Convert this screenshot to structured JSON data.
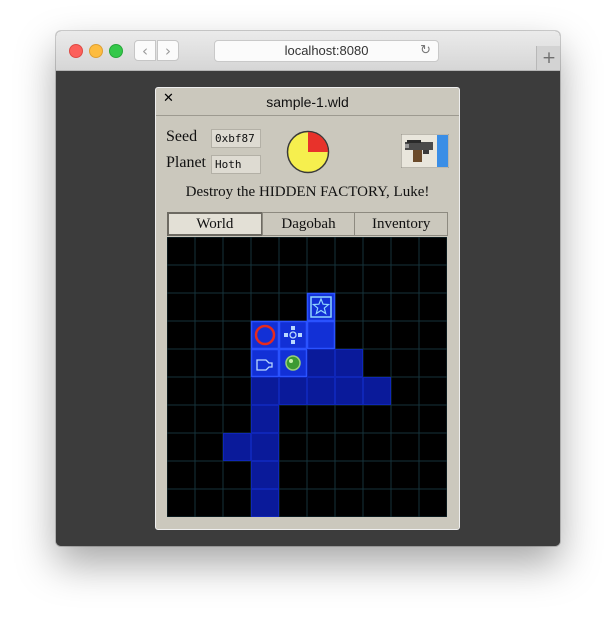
{
  "browser": {
    "url": "localhost:8080",
    "back_glyph": "‹",
    "forward_glyph": "›",
    "reload_glyph": "↻",
    "new_tab_glyph": "+"
  },
  "dialog": {
    "close_glyph": "✕",
    "title": "sample-1.wld"
  },
  "fields": {
    "seed_label": "Seed",
    "seed_value": "0xbf87",
    "planet_label": "Planet",
    "planet_value": "Hoth"
  },
  "objective": "Destroy the HIDDEN FACTORY, Luke!",
  "progress": {
    "red_fraction": 0.25,
    "red_color": "#e8322b",
    "yellow_color": "#f6ef4e"
  },
  "tabs": [
    {
      "label": "World",
      "active": true
    },
    {
      "label": "Dagobah",
      "active": false
    },
    {
      "label": "Inventory",
      "active": false
    }
  ],
  "map": {
    "cols": 10,
    "rows": 10,
    "grid_color": "#16323a",
    "zone_color": "#0a1a9a",
    "highlight_color": "#2a52ff",
    "zones": [
      [
        5,
        2
      ],
      [
        3,
        3
      ],
      [
        4,
        3
      ],
      [
        5,
        3
      ],
      [
        3,
        4
      ],
      [
        4,
        4
      ],
      [
        5,
        4
      ],
      [
        6,
        4
      ],
      [
        3,
        5
      ],
      [
        4,
        5
      ],
      [
        5,
        5
      ],
      [
        6,
        5
      ],
      [
        7,
        5
      ],
      [
        3,
        6
      ],
      [
        3,
        7
      ],
      [
        2,
        7
      ],
      [
        3,
        7
      ],
      [
        3,
        8
      ],
      [
        3,
        9
      ]
    ],
    "highlighted": [
      [
        5,
        2
      ],
      [
        3,
        3
      ],
      [
        4,
        3
      ],
      [
        5,
        3
      ],
      [
        3,
        4
      ],
      [
        4,
        4
      ]
    ],
    "markers": [
      {
        "col": 5,
        "row": 2,
        "icon": "star-icon"
      },
      {
        "col": 3,
        "row": 3,
        "icon": "red-ring-icon"
      },
      {
        "col": 4,
        "row": 3,
        "icon": "crossroads-icon"
      },
      {
        "col": 3,
        "row": 4,
        "icon": "hand-icon"
      },
      {
        "col": 4,
        "row": 4,
        "icon": "green-orb-icon"
      }
    ]
  },
  "weapon_icon": "blaster-icon"
}
